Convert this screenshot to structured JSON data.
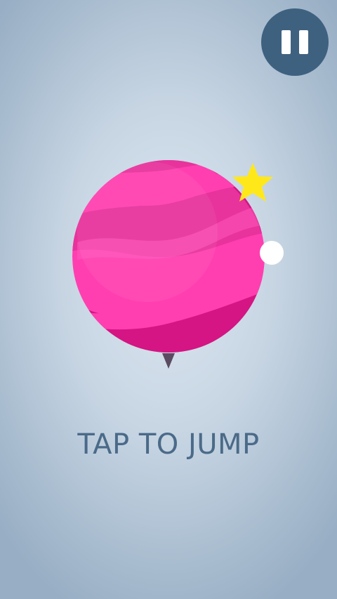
{
  "hud": {
    "pause_icon": "pause-icon",
    "pause_color": "#3f6180"
  },
  "game": {
    "planet_colors": [
      "#ff3fb0",
      "#e8329c",
      "#d41583"
    ],
    "star_color": "#ffe81a",
    "orb_color": "#ffffff",
    "spike_color": "#5a4b63",
    "prompt_text": "TAP TO JUMP",
    "prompt_color": "#4a6a88"
  }
}
